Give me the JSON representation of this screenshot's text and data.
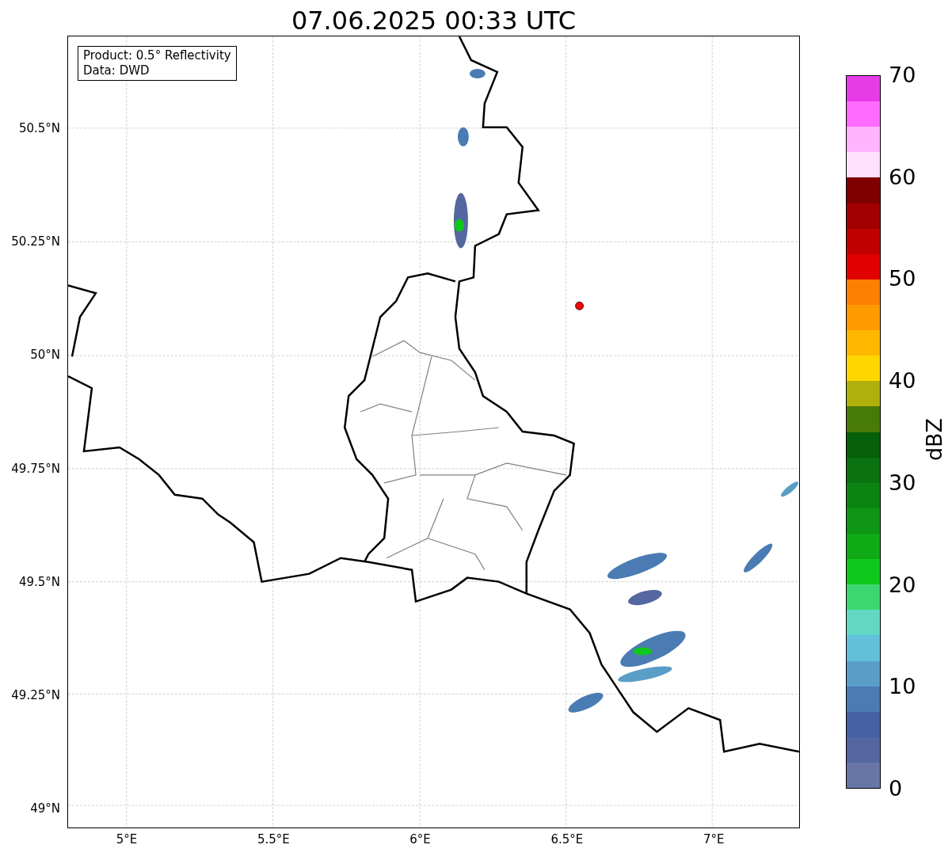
{
  "title": "07.06.2025 00:33 UTC",
  "legend": [
    "Product: 0.5° Reflectivity",
    "Data: DWD"
  ],
  "y_ticks": [
    "50.5°N",
    "50.25°N",
    "50°N",
    "49.75°N",
    "49.5°N",
    "49.25°N",
    "49°N"
  ],
  "x_ticks": [
    "5°E",
    "5.5°E",
    "6°E",
    "6.5°E",
    "7°E"
  ],
  "colorbar": {
    "label": "dBZ",
    "ticks": [
      "70",
      "60",
      "50",
      "40",
      "30",
      "20",
      "10",
      "0"
    ],
    "bands": [
      {
        "color": "#e83be8"
      },
      {
        "color": "#ff6bff"
      },
      {
        "color": "#ffb4ff"
      },
      {
        "color": "#ffe0ff"
      },
      {
        "color": "#800000"
      },
      {
        "color": "#a00000"
      },
      {
        "color": "#c00000"
      },
      {
        "color": "#e00000"
      },
      {
        "color": "#ff7f00"
      },
      {
        "color": "#ff9a00"
      },
      {
        "color": "#ffb800"
      },
      {
        "color": "#ffd700"
      },
      {
        "color": "#b0b00a"
      },
      {
        "color": "#487a0a"
      },
      {
        "color": "#06600a"
      },
      {
        "color": "#0a7210"
      },
      {
        "color": "#0c8412"
      },
      {
        "color": "#0e9614"
      },
      {
        "color": "#10aa16"
      },
      {
        "color": "#10c81c"
      },
      {
        "color": "#3dd770"
      },
      {
        "color": "#62d8c4"
      },
      {
        "color": "#63c0da"
      },
      {
        "color": "#5a9ec7"
      },
      {
        "color": "#4a7bb3"
      },
      {
        "color": "#4560a3"
      },
      {
        "color": "#5467a0"
      },
      {
        "color": "#6776a6"
      }
    ]
  }
}
